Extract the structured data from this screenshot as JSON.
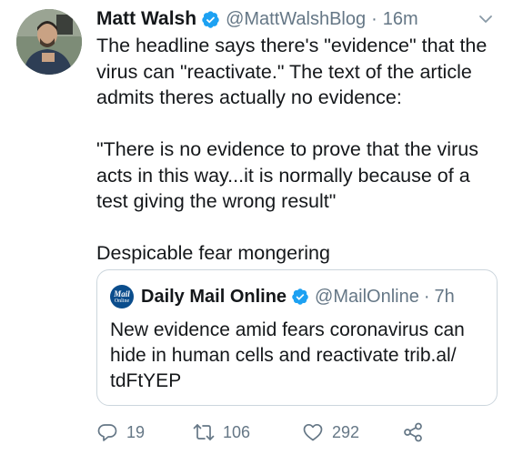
{
  "tweet": {
    "author_name": "Matt Walsh",
    "author_handle": "@MattWalshBlog",
    "separator": "·",
    "time": "16m",
    "text_lines": [
      "The headline says there's \"evidence\" that the",
      "virus can \"reactivate.\" The text of the article",
      "admits theres actually no evidence:",
      "",
      "\"There is no evidence to prove that the virus",
      "acts in this way...it is normally because of a",
      "test giving the wrong result\"",
      "",
      "Despicable fear mongering"
    ]
  },
  "quoted": {
    "logo_line1": "Mail",
    "logo_line2": "Online",
    "author_name": "Daily Mail Online",
    "author_handle": "@MailOnline",
    "separator": "·",
    "time": "7h",
    "text_lines": [
      "New evidence amid fears coronavirus can",
      "hide in human cells and reactivate trib.al/",
      "tdFtYEP"
    ]
  },
  "actions": {
    "replies": "19",
    "retweets": "106",
    "likes": "292"
  },
  "colors": {
    "verified": "#1da1f2",
    "secondary_text": "#657786",
    "border": "#ccd6dd"
  },
  "icons": [
    "verified-badge-icon",
    "chevron-down-icon",
    "reply-icon",
    "retweet-icon",
    "like-icon",
    "share-icon"
  ]
}
